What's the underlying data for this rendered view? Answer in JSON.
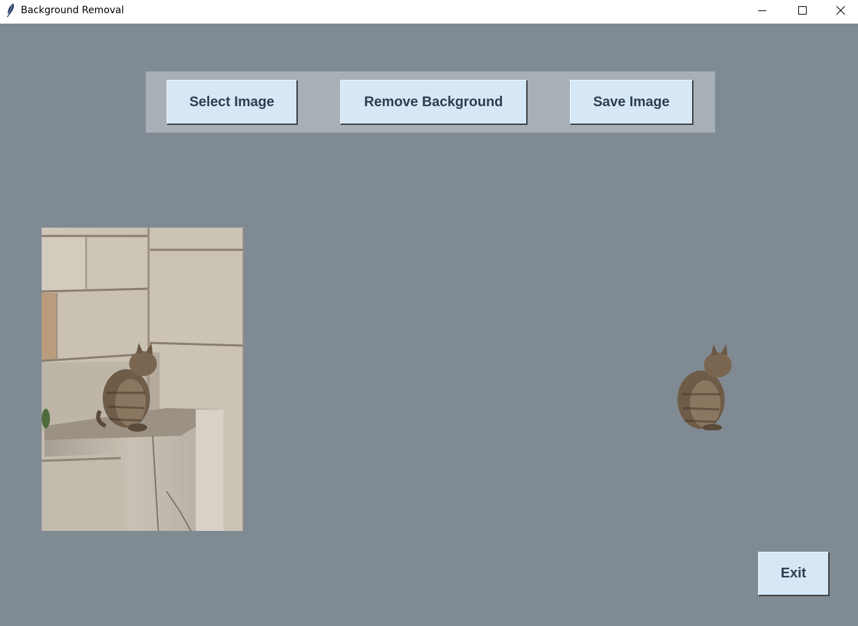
{
  "window": {
    "title": "Background Removal",
    "app_icon": "feather-icon",
    "controls": [
      "minimize-icon",
      "maximize-icon",
      "close-icon"
    ]
  },
  "toolbar": {
    "select_label": "Select Image",
    "remove_label": "Remove Background",
    "save_label": "Save Image"
  },
  "footer": {
    "exit_label": "Exit"
  },
  "images": {
    "original": "cat-on-stone-ruins-photo",
    "result": "cat-background-removed-photo"
  },
  "colors": {
    "window_bg": "#808a93",
    "toolbar_bg": "#a8b0b7",
    "button_bg": "#d6e7f5",
    "button_text": "#2c3e50"
  }
}
